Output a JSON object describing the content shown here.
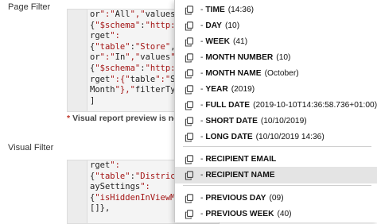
{
  "page_filter_label": "Page Filter",
  "visual_filter_label": "Visual Filter",
  "page_filter_code": [
    {
      "text": "or\":\"All\",\"values\""
    },
    {
      "text": "{\"$schema\":\"http:/"
    },
    {
      "text": "rget\":"
    },
    {
      "text": "{\"table\":\"Store\",\""
    },
    {
      "text": "or\":\"In\",\"values\":["
    },
    {
      "text": "{\"$schema\":\"http:/"
    },
    {
      "text": "rget\":{\"table\":\"St"
    },
    {
      "text": "Month\"},\"filterTyp"
    },
    {
      "text": "]"
    }
  ],
  "preview_note": "Visual report preview is no",
  "visual_filter_code": [
    {
      "text": "rget\":"
    },
    {
      "text": "{\"table\":\"Distric"
    },
    {
      "text": "aySettings\":"
    },
    {
      "text": "{\"isHiddenInViewM"
    },
    {
      "text": "[]},"
    }
  ],
  "menu": {
    "items": [
      {
        "label": "TIME",
        "value": "(14:36)"
      },
      {
        "label": "DAY",
        "value": "(10)"
      },
      {
        "label": "WEEK",
        "value": "(41)"
      },
      {
        "label": "MONTH NUMBER",
        "value": "(10)"
      },
      {
        "label": "MONTH NAME",
        "value": "(October)"
      },
      {
        "label": "YEAR",
        "value": "(2019)"
      },
      {
        "label": "FULL DATE",
        "value": "(2019-10-10T14:36:58.736+01:00)"
      },
      {
        "label": "SHORT DATE",
        "value": "(10/10/2019)"
      },
      {
        "label": "LONG DATE",
        "value": "(10/10/2019 14:36)"
      },
      {
        "label": "RECIPIENT EMAIL",
        "value": ""
      },
      {
        "label": "RECIPIENT NAME",
        "value": ""
      },
      {
        "label": "PREVIOUS DAY",
        "value": "(09)"
      },
      {
        "label": "PREVIOUS WEEK",
        "value": "(40)"
      }
    ],
    "active_index": 10,
    "icon": "copy-icon",
    "icon_color": "#444444"
  },
  "colors": {
    "string": "#a31515",
    "selection": "#dfe4ea",
    "menu_hover": "#e4e4e4"
  }
}
